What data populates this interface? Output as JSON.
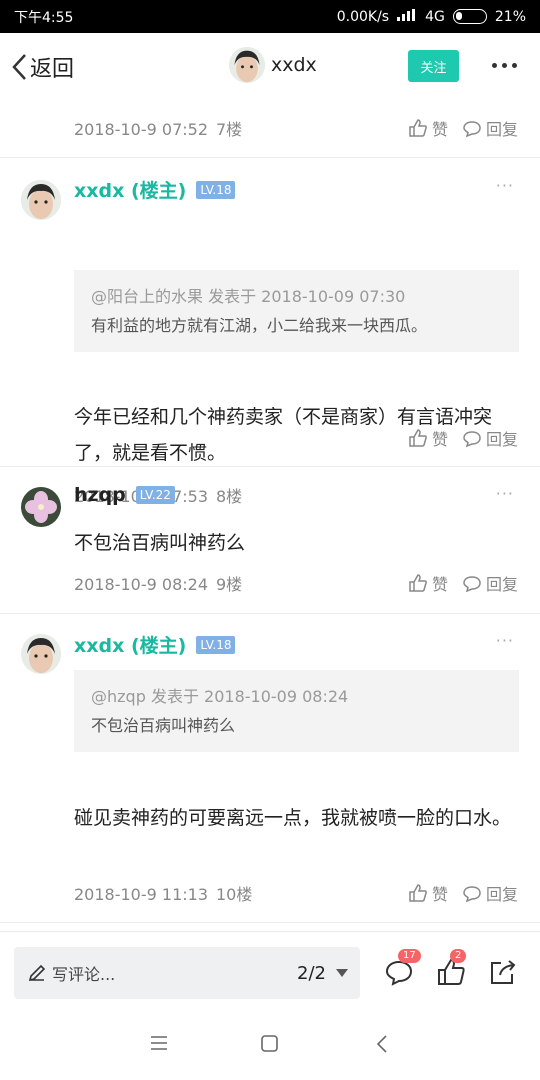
{
  "status_bar": {
    "time": "下午4:55",
    "net_speed": "0.00K/s",
    "network": "4G",
    "battery": "21%"
  },
  "nav": {
    "back_label": "返回",
    "username": "xxdx",
    "follow_label": "关注"
  },
  "top_meta": {
    "date": "2018-10-9 07:52",
    "floor": "7楼",
    "like_label": "赞",
    "reply_label": "回复"
  },
  "posts": [
    {
      "name": "xxdx (楼主)",
      "level": "LV.18",
      "quote_head": "@阳台上的水果 发表于 2018-10-09 07:30",
      "quote_body": "有利益的地方就有江湖，小二给我来一块西瓜。",
      "body": "今年已经和几个神药卖家（不是商家）有言语冲突了，就是看不惯。",
      "date": "2018-10-9 07:53",
      "floor": "8楼",
      "like_label": "赞",
      "reply_label": "回复"
    },
    {
      "name": "hzqp",
      "level": "LV.22",
      "body": "不包治百病叫神药么",
      "date": "2018-10-9 08:24",
      "floor": "9楼",
      "like_label": "赞",
      "reply_label": "回复"
    },
    {
      "name": "xxdx (楼主)",
      "level": "LV.18",
      "quote_head": "@hzqp 发表于 2018-10-09 08:24",
      "quote_body": "不包治百病叫神药么",
      "body": "碰见卖神药的可要离远一点，我就被喷一脸的口水。",
      "date": "2018-10-9 11:13",
      "floor": "10楼",
      "like_label": "赞",
      "reply_label": "回复"
    }
  ],
  "bottom": {
    "comment_placeholder": "写评论...",
    "pager": "2/2",
    "comment_count": "17",
    "like_count": "2"
  },
  "colors": {
    "accent": "#1fc9b0",
    "name_accent": "#19b9a1",
    "level_badge": "#7fb0e6",
    "badge_red": "#f56565"
  }
}
